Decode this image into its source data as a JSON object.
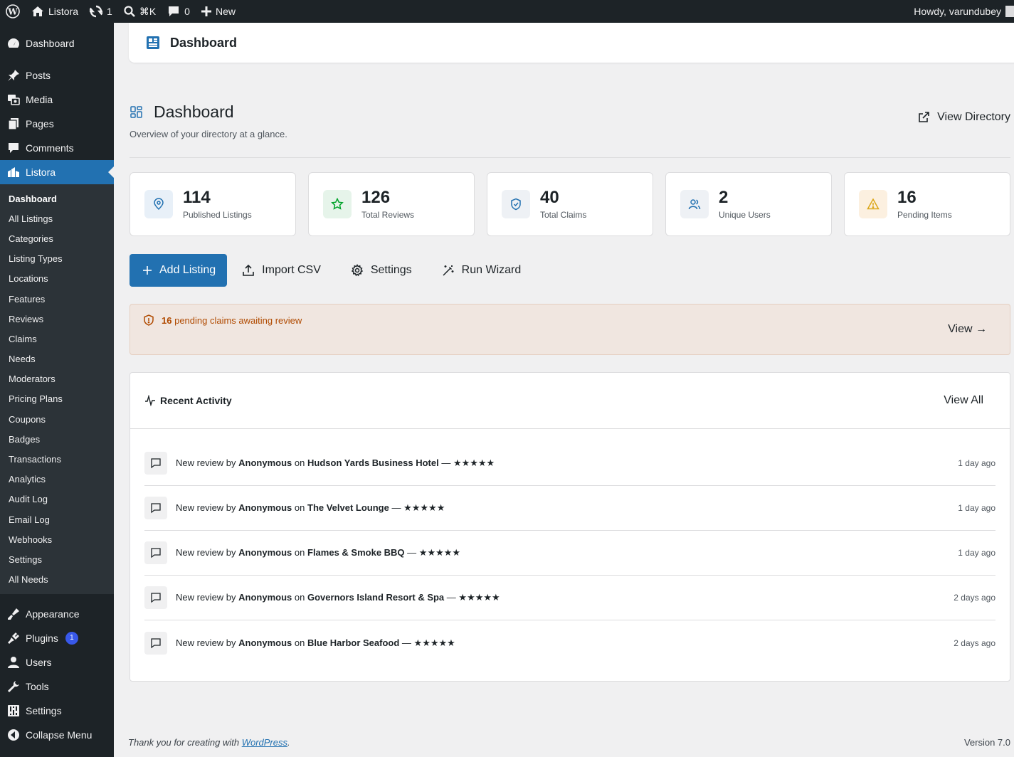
{
  "adminbar": {
    "site_name": "Listora",
    "updates_count": "1",
    "search_shortcut": "⌘K",
    "comments_count": "0",
    "new_label": "New",
    "howdy": "Howdy, varundubey"
  },
  "sidebar": {
    "top_items": [
      {
        "label": "Dashboard",
        "icon": "dashboard-icon"
      },
      {
        "label": "Posts",
        "icon": "pin-icon"
      },
      {
        "label": "Media",
        "icon": "media-icon"
      },
      {
        "label": "Pages",
        "icon": "pages-icon"
      },
      {
        "label": "Comments",
        "icon": "comment-icon"
      },
      {
        "label": "Listora",
        "icon": "listora-icon"
      }
    ],
    "submenu": [
      "Dashboard",
      "All Listings",
      "Categories",
      "Listing Types",
      "Locations",
      "Features",
      "Reviews",
      "Claims",
      "Needs",
      "Moderators",
      "Pricing Plans",
      "Coupons",
      "Badges",
      "Transactions",
      "Analytics",
      "Audit Log",
      "Email Log",
      "Webhooks",
      "Settings",
      "All Needs"
    ],
    "bottom_items": [
      {
        "label": "Appearance",
        "icon": "brush-icon"
      },
      {
        "label": "Plugins",
        "icon": "plugin-icon",
        "badge": "1"
      },
      {
        "label": "Users",
        "icon": "user-icon"
      },
      {
        "label": "Tools",
        "icon": "wrench-icon"
      },
      {
        "label": "Settings",
        "icon": "settings-icon"
      },
      {
        "label": "Collapse Menu",
        "icon": "collapse-icon"
      }
    ]
  },
  "header": {
    "title": "Dashboard"
  },
  "page": {
    "title": "Dashboard",
    "subtitle": "Overview of your directory at a glance.",
    "view_directory": "View Directory"
  },
  "stats": [
    {
      "value": "114",
      "label": "Published Listings",
      "icon": "location-pin-icon",
      "color": "#2271b1",
      "bg": "#e8f0f8"
    },
    {
      "value": "126",
      "label": "Total Reviews",
      "icon": "star-icon",
      "color": "#00a32a",
      "bg": "#e6f4ea"
    },
    {
      "value": "40",
      "label": "Total Claims",
      "icon": "shield-icon",
      "color": "#2271b1",
      "bg": "#eef1f5"
    },
    {
      "value": "2",
      "label": "Unique Users",
      "icon": "users-icon",
      "color": "#2271b1",
      "bg": "#eef1f5"
    },
    {
      "value": "16",
      "label": "Pending Items",
      "icon": "warning-icon",
      "color": "#dba617",
      "bg": "#fcf0e0"
    }
  ],
  "actions": {
    "add_listing": "Add Listing",
    "import_csv": "Import CSV",
    "settings": "Settings",
    "run_wizard": "Run Wizard"
  },
  "notice": {
    "count": "16",
    "text": "pending claims awaiting review",
    "view": "View →"
  },
  "activity": {
    "title": "Recent Activity",
    "view_all": "View All",
    "items": [
      {
        "prefix": "New review by",
        "user": "Anonymous",
        "on": "on",
        "target": "Hudson Yards Business Hotel",
        "stars": "— ★★★★★",
        "time": "1 day ago"
      },
      {
        "prefix": "New review by",
        "user": "Anonymous",
        "on": "on",
        "target": "The Velvet Lounge",
        "stars": "— ★★★★★",
        "time": "1 day ago"
      },
      {
        "prefix": "New review by",
        "user": "Anonymous",
        "on": "on",
        "target": "Flames & Smoke BBQ",
        "stars": "— ★★★★★",
        "time": "1 day ago"
      },
      {
        "prefix": "New review by",
        "user": "Anonymous",
        "on": "on",
        "target": "Governors Island Resort & Spa",
        "stars": "— ★★★★★",
        "time": "2 days ago"
      },
      {
        "prefix": "New review by",
        "user": "Anonymous",
        "on": "on",
        "target": "Blue Harbor Seafood",
        "stars": "— ★★★★★",
        "time": "2 days ago"
      }
    ]
  },
  "footer": {
    "thanks": "Thank you for creating with ",
    "link": "WordPress",
    "period": ".",
    "version": "Version 7.0"
  }
}
